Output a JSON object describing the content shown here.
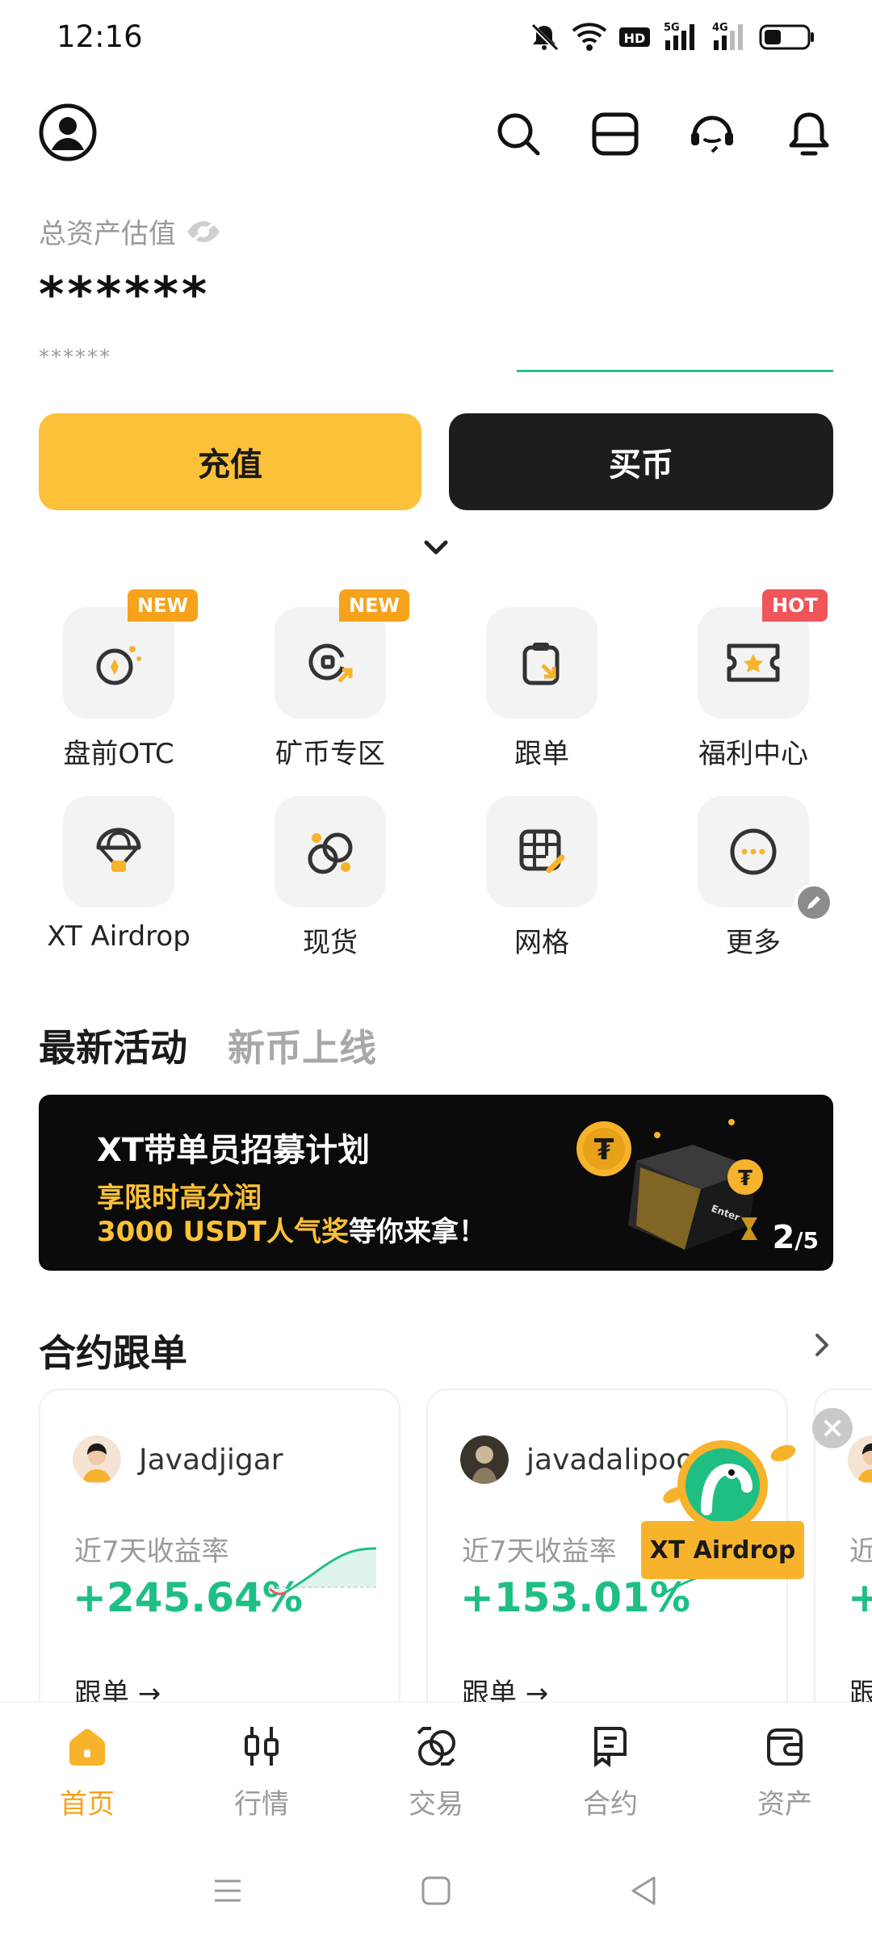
{
  "status_bar": {
    "time": "12:16"
  },
  "asset": {
    "label": "总资产估值",
    "value": "******",
    "sub_value": "******"
  },
  "actions": {
    "deposit_label": "充值",
    "buy_label": "买币"
  },
  "shortcuts": [
    {
      "label": "盘前OTC",
      "badge": "NEW",
      "icon": "pre-market-otc-icon"
    },
    {
      "label": "矿币专区",
      "badge": "NEW",
      "icon": "mining-coin-icon"
    },
    {
      "label": "跟单",
      "badge": "",
      "icon": "copy-trade-icon"
    },
    {
      "label": "福利中心",
      "badge": "HOT",
      "icon": "rewards-center-icon"
    },
    {
      "label": "XT Airdrop",
      "badge": "",
      "icon": "airdrop-icon"
    },
    {
      "label": "现货",
      "badge": "",
      "icon": "spot-icon"
    },
    {
      "label": "网格",
      "badge": "",
      "icon": "grid-trading-icon"
    },
    {
      "label": "更多",
      "badge": "",
      "icon": "more-icon"
    }
  ],
  "activity_tabs": {
    "active": "最新活动",
    "inactive": "新币上线"
  },
  "banner": {
    "title": "XT带单员招募计划",
    "line1": "享限时高分润",
    "line2_highlight": "3000 USDT人气奖",
    "line2_rest": "等你来拿！",
    "page_current": "2",
    "page_total": "/5",
    "art_text": "Enter"
  },
  "copy_trading": {
    "title": "合约跟单",
    "traders": [
      {
        "name": "Javadjigar",
        "return_label": "近7天收益率",
        "return_value": "+245.64%",
        "follow_label": "跟单 →"
      },
      {
        "name": "javadalipoor",
        "return_label": "近7天收益率",
        "return_value": "+153.01%",
        "follow_label": "跟单 →"
      }
    ],
    "peek_label": "近",
    "peek_value": "+",
    "peek_follow": "跟"
  },
  "airdrop_float": {
    "label": "XT Airdrop"
  },
  "bottom_nav": [
    {
      "label": "首页",
      "icon": "home-icon",
      "active": true
    },
    {
      "label": "行情",
      "icon": "market-icon",
      "active": false
    },
    {
      "label": "交易",
      "icon": "trade-icon",
      "active": false
    },
    {
      "label": "合约",
      "icon": "futures-icon",
      "active": false
    },
    {
      "label": "资产",
      "icon": "assets-icon",
      "active": false
    }
  ],
  "colors": {
    "accent": "#fcc138",
    "positive": "#1fbf83",
    "dark": "#1d1d1d",
    "badge_new": "#f7a21b",
    "badge_hot": "#f0555a"
  }
}
